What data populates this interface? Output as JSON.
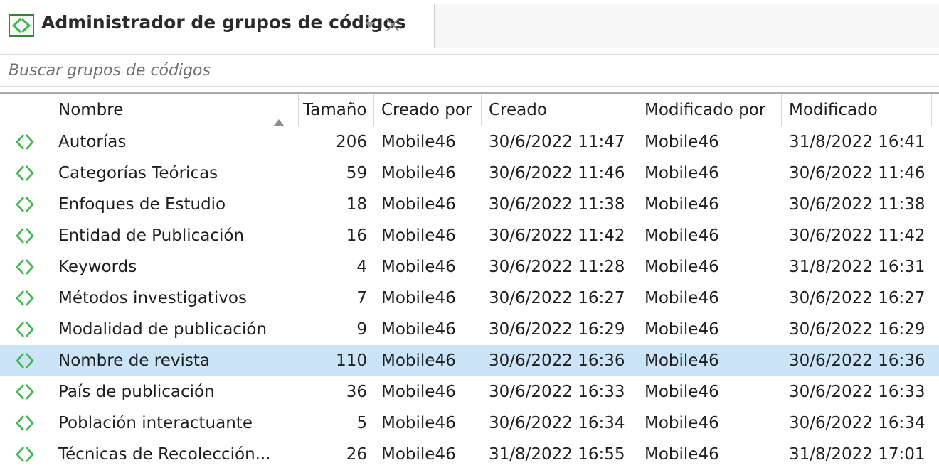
{
  "tab": {
    "title": "Administrador de grupos de códigos",
    "icon": "code-group-icon",
    "dropdown_icon": "chevron-down-icon",
    "close_icon": "close-icon"
  },
  "search": {
    "placeholder": "Buscar grupos de códigos",
    "value": ""
  },
  "colors": {
    "icon_green": "#3fb34f",
    "selected_row": "#cce4f7"
  },
  "table": {
    "columns": [
      "Nombre",
      "Tamaño",
      "Creado por",
      "Creado",
      "Modificado por",
      "Modificado"
    ],
    "sort_column": "Nombre",
    "sort_direction": "ascending",
    "selected_row": "Nombre de revista",
    "rows": [
      {
        "name": "Autorías",
        "size": "206",
        "created_by": "Mobile46",
        "created": "30/6/2022 11:47",
        "modified_by": "Mobile46",
        "modified": "31/8/2022 16:41"
      },
      {
        "name": "Categorías Teóricas",
        "size": "59",
        "created_by": "Mobile46",
        "created": "30/6/2022 11:46",
        "modified_by": "Mobile46",
        "modified": "30/6/2022 11:46"
      },
      {
        "name": "Enfoques de Estudio",
        "size": "18",
        "created_by": "Mobile46",
        "created": "30/6/2022 11:38",
        "modified_by": "Mobile46",
        "modified": "30/6/2022 11:38"
      },
      {
        "name": "Entidad de Publicación",
        "size": "16",
        "created_by": "Mobile46",
        "created": "30/6/2022 11:42",
        "modified_by": "Mobile46",
        "modified": "30/6/2022 11:42"
      },
      {
        "name": "Keywords",
        "size": "4",
        "created_by": "Mobile46",
        "created": "30/6/2022 11:28",
        "modified_by": "Mobile46",
        "modified": "31/8/2022 16:31"
      },
      {
        "name": "Métodos investigativos",
        "size": "7",
        "created_by": "Mobile46",
        "created": "30/6/2022 16:27",
        "modified_by": "Mobile46",
        "modified": "30/6/2022 16:27"
      },
      {
        "name": "Modalidad de publicación",
        "size": "9",
        "created_by": "Mobile46",
        "created": "30/6/2022 16:29",
        "modified_by": "Mobile46",
        "modified": "30/6/2022 16:29"
      },
      {
        "name": "Nombre de revista",
        "size": "110",
        "created_by": "Mobile46",
        "created": "30/6/2022 16:36",
        "modified_by": "Mobile46",
        "modified": "30/6/2022 16:36"
      },
      {
        "name": "País de publicación",
        "size": "36",
        "created_by": "Mobile46",
        "created": "30/6/2022 16:33",
        "modified_by": "Mobile46",
        "modified": "30/6/2022 16:33"
      },
      {
        "name": "Población interactuante",
        "size": "5",
        "created_by": "Mobile46",
        "created": "30/6/2022 16:34",
        "modified_by": "Mobile46",
        "modified": "30/6/2022 16:34"
      },
      {
        "name": "Técnicas de Recolección...",
        "size": "26",
        "created_by": "Mobile46",
        "created": "31/8/2022 16:55",
        "modified_by": "Mobile46",
        "modified": "31/8/2022 17:01"
      }
    ]
  }
}
